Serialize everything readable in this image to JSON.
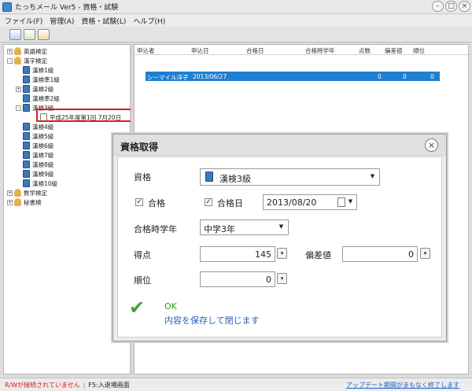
{
  "window": {
    "title": "たっちメール Ver5 - 資格・試験",
    "controls": [
      "–",
      "□",
      "×"
    ]
  },
  "menu": [
    "ファイル(F)",
    "管理(A)",
    "資格・試験(L)",
    "ヘルプ(H)"
  ],
  "toolbar": {
    "icons": [
      "list-view-icon",
      "form-icon",
      "tools-icon"
    ]
  },
  "tree": [
    {
      "label": "英語検定",
      "icon": "person-icon",
      "expander": "+"
    },
    {
      "label": "漢字検定",
      "icon": "person-icon",
      "expander": "-"
    },
    {
      "label": "漢検1級",
      "icon": "book-icon"
    },
    {
      "label": "漢検準1級",
      "icon": "book-icon"
    },
    {
      "label": "漢検2級",
      "icon": "book-icon",
      "expander": "+"
    },
    {
      "label": "漢検準2級",
      "icon": "book-icon"
    },
    {
      "label": "漢検3級",
      "icon": "book-icon",
      "expander": "-"
    },
    {
      "label": "平成25年度第1回 7月20日",
      "icon": "calendar-icon"
    },
    {
      "label": "漢検4級",
      "icon": "book-icon"
    },
    {
      "label": "漢検5級",
      "icon": "book-icon"
    },
    {
      "label": "漢検6級",
      "icon": "book-icon"
    },
    {
      "label": "漢検7級",
      "icon": "book-icon"
    },
    {
      "label": "漢検8級",
      "icon": "book-icon"
    },
    {
      "label": "漢検9級",
      "icon": "book-icon"
    },
    {
      "label": "漢検10級",
      "icon": "book-icon"
    },
    {
      "label": "数学検定",
      "icon": "person-icon",
      "expander": "+"
    },
    {
      "label": "秘書検",
      "icon": "person-icon",
      "expander": "+"
    }
  ],
  "grid": {
    "columns": [
      "申込者",
      "申込日",
      "合格日",
      "合格時学年",
      "点数",
      "偏差値",
      "順位"
    ],
    "rows": [
      {
        "applicant": "シーマイル洋子",
        "apply_date": "2013/06/27",
        "pass_date": "",
        "grade": "",
        "score": "0",
        "deviation": "0",
        "rank": "0"
      }
    ]
  },
  "dialog": {
    "title": "資格取得",
    "qualification_label": "資格",
    "qualification_value": "漢検3級",
    "passed_label": "合格",
    "pass_date_label": "合格日",
    "pass_date_value": "2013/08/20",
    "grade_label": "合格時学年",
    "grade_value": "中学3年",
    "score_label": "得点",
    "score_value": "145",
    "deviation_label": "偏差値",
    "deviation_value": "0",
    "rank_label": "順位",
    "rank_value": "0",
    "ok_title": "OK",
    "ok_desc": "内容を保存して閉じます",
    "close_glyph": "×",
    "check_glyph": "✓",
    "ok_glyph": "✔",
    "dropdown_glyph": "▼",
    "spin_glyph": "▾"
  },
  "status": {
    "warning": "R/Wが接続されていません",
    "hint": "F5:入退場画面",
    "update_link": "アップデート期間がまもなく終了します"
  },
  "colors": {
    "selection": "#1e7fd3",
    "highlight": "#e01b1b",
    "ok_green": "#2b9a2b",
    "link_blue": "#2a5db8"
  }
}
